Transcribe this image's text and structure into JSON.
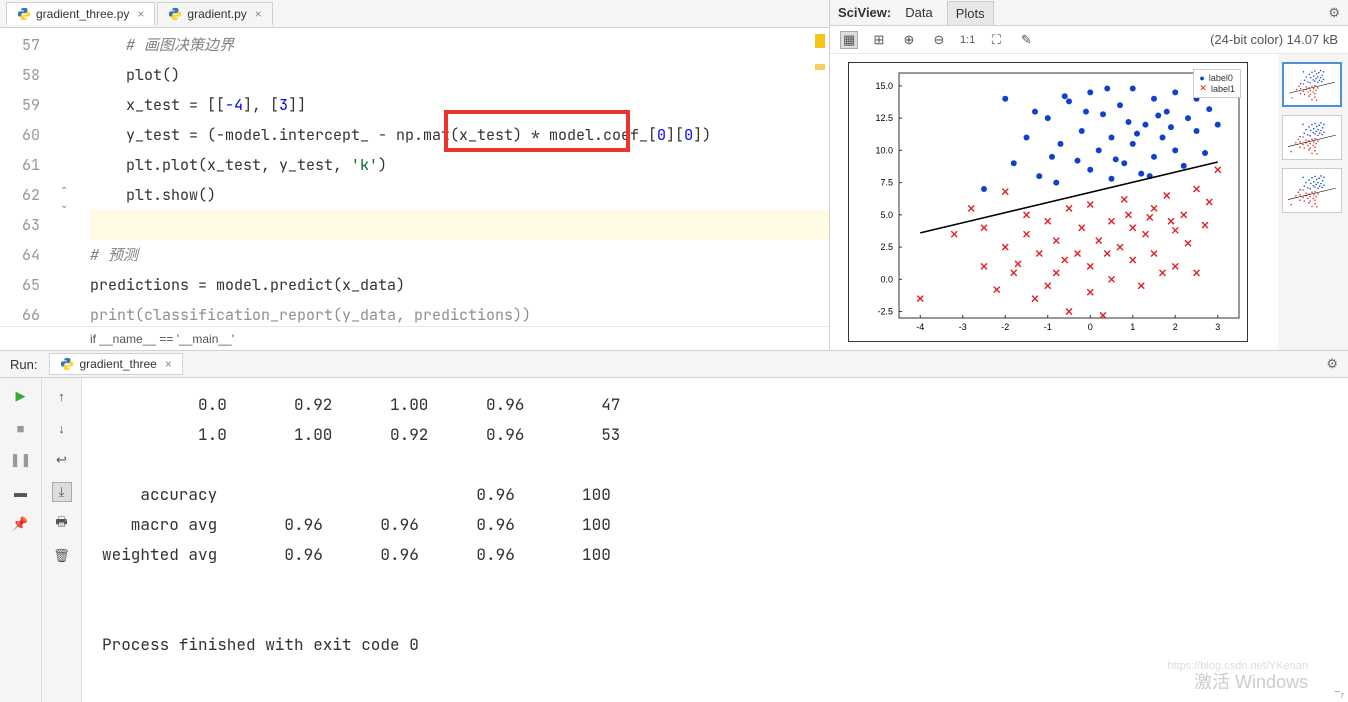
{
  "tabs": {
    "file1": "gradient_three.py",
    "file2": "gradient.py"
  },
  "gutter": [
    "57",
    "58",
    "59",
    "60",
    "61",
    "62",
    "63",
    "64",
    "65",
    "66"
  ],
  "code": {
    "l57_comment": "# 画图决策边界",
    "l58": "plot()",
    "l59_a": "x_test = [[",
    "l59_n1": "-4",
    "l59_b": "], [",
    "l59_n2": "3",
    "l59_c": "]]",
    "l60_a": "y_test = (-model.intercept_ - np.mat(x_test) * model.coef_[",
    "l60_n1": "0",
    "l60_b": "][",
    "l60_n2": "0",
    "l60_c": "])",
    "l61_a": "plt.plot(x_test, y_test, ",
    "l61_s": "'k'",
    "l61_b": ")",
    "l62": "plt.show()",
    "l63": "",
    "l64_comment": "# 预测",
    "l65": "predictions = model.predict(x_data)",
    "l66": "print(classification_report(y_data, predictions))"
  },
  "breadcrumb": "if __name__ == '__main__'",
  "sciview": {
    "label": "SciView:",
    "tab_data": "Data",
    "tab_plots": "Plots",
    "info": "(24-bit color) 14.07 kB",
    "oneToOne": "1:1",
    "legend0": "label0",
    "legend1": "label1"
  },
  "run": {
    "label": "Run:",
    "tab": "gradient_three"
  },
  "console": "          0.0       0.92      1.00      0.96        47\n          1.0       1.00      0.92      0.96        53\n\n    accuracy                           0.96       100\n   macro avg       0.96      0.96      0.96       100\nweighted avg       0.96      0.96      0.96       100\n\n\nProcess finished with exit code 0",
  "watermark": "激活 Windows",
  "watermark2": "https://blog.csdn.net/YKenan",
  "chart_data": {
    "type": "scatter",
    "xlabel": "",
    "ylabel": "",
    "xlim": [
      -4.5,
      3.5
    ],
    "ylim": [
      -3,
      16
    ],
    "xticks": [
      -4,
      -3,
      -2,
      -1,
      0,
      1,
      2,
      3
    ],
    "yticks": [
      -2.5,
      0.0,
      2.5,
      5.0,
      7.5,
      10.0,
      12.5,
      15.0
    ],
    "series": [
      {
        "name": "label0",
        "marker": "dot",
        "color": "#1040d0",
        "points": [
          [
            -2.5,
            7
          ],
          [
            -2,
            14
          ],
          [
            -1.8,
            9
          ],
          [
            -1.5,
            11
          ],
          [
            -1.2,
            8
          ],
          [
            -1,
            12.5
          ],
          [
            -0.8,
            7.5
          ],
          [
            -0.7,
            10.5
          ],
          [
            -0.5,
            13.8
          ],
          [
            -0.3,
            9.2
          ],
          [
            -0.2,
            11.5
          ],
          [
            0,
            8.5
          ],
          [
            0,
            14.5
          ],
          [
            0.2,
            10
          ],
          [
            0.3,
            12.8
          ],
          [
            0.5,
            7.8
          ],
          [
            0.5,
            11
          ],
          [
            0.7,
            13.5
          ],
          [
            0.8,
            9
          ],
          [
            1,
            14.8
          ],
          [
            1,
            10.5
          ],
          [
            1.2,
            8.2
          ],
          [
            1.3,
            12
          ],
          [
            1.5,
            14
          ],
          [
            1.5,
            9.5
          ],
          [
            1.7,
            11
          ],
          [
            1.8,
            13
          ],
          [
            2,
            10
          ],
          [
            2,
            14.5
          ],
          [
            2.2,
            8.8
          ],
          [
            2.3,
            12.5
          ],
          [
            2.5,
            11.5
          ],
          [
            2.5,
            14
          ],
          [
            2.7,
            9.8
          ],
          [
            2.8,
            13.2
          ],
          [
            3,
            12
          ],
          [
            -0.6,
            14.2
          ],
          [
            0.4,
            14.8
          ],
          [
            0.9,
            12.2
          ],
          [
            1.4,
            8
          ],
          [
            1.9,
            11.8
          ],
          [
            -1.3,
            13
          ],
          [
            -0.9,
            9.5
          ],
          [
            -0.1,
            13
          ],
          [
            0.6,
            9.3
          ],
          [
            1.1,
            11.3
          ],
          [
            1.6,
            12.7
          ]
        ]
      },
      {
        "name": "label1",
        "marker": "x",
        "color": "#e02020",
        "points": [
          [
            -4,
            -1.5
          ],
          [
            -3.2,
            3.5
          ],
          [
            -2.8,
            5.5
          ],
          [
            -2.5,
            1
          ],
          [
            -2.5,
            4
          ],
          [
            -2,
            2.5
          ],
          [
            -2,
            6.8
          ],
          [
            -1.8,
            0.5
          ],
          [
            -1.5,
            3.5
          ],
          [
            -1.5,
            5
          ],
          [
            -1.2,
            2
          ],
          [
            -1,
            4.5
          ],
          [
            -1,
            -0.5
          ],
          [
            -0.8,
            0.5
          ],
          [
            -0.8,
            3
          ],
          [
            -0.5,
            5.5
          ],
          [
            -0.5,
            -2.5
          ],
          [
            -0.3,
            2
          ],
          [
            -0.2,
            4
          ],
          [
            0,
            1
          ],
          [
            0,
            -1
          ],
          [
            0,
            5.8
          ],
          [
            0.2,
            3
          ],
          [
            0.3,
            -2.8
          ],
          [
            0.5,
            4.5
          ],
          [
            0.5,
            0
          ],
          [
            0.7,
            2.5
          ],
          [
            0.8,
            6.2
          ],
          [
            1,
            1.5
          ],
          [
            1,
            4
          ],
          [
            1.2,
            -0.5
          ],
          [
            1.3,
            3.5
          ],
          [
            1.5,
            5.5
          ],
          [
            1.5,
            2
          ],
          [
            1.7,
            0.5
          ],
          [
            1.8,
            6.5
          ],
          [
            2,
            3.8
          ],
          [
            2,
            1
          ],
          [
            2.2,
            5
          ],
          [
            2.3,
            2.8
          ],
          [
            2.5,
            7
          ],
          [
            2.5,
            0.5
          ],
          [
            2.7,
            4.2
          ],
          [
            2.8,
            6
          ],
          [
            3,
            8.5
          ],
          [
            -2.2,
            -0.8
          ],
          [
            -1.7,
            1.2
          ],
          [
            -1.3,
            -1.5
          ],
          [
            -0.6,
            1.5
          ],
          [
            0.4,
            2
          ],
          [
            0.9,
            5
          ],
          [
            1.4,
            4.8
          ],
          [
            1.9,
            4.5
          ]
        ]
      }
    ],
    "line": {
      "x": [
        -4,
        3
      ],
      "y": [
        3.6,
        9.1
      ],
      "color": "#000"
    }
  }
}
